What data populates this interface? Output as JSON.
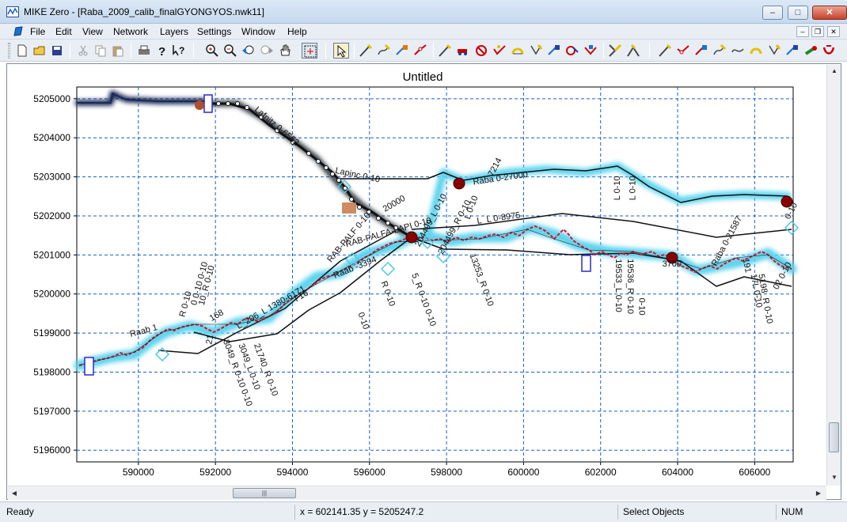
{
  "window": {
    "title": "MIKE Zero - [Raba_2009_calib_finalGYONGYOS.nwk11]",
    "minimize": "–",
    "maximize": "□",
    "close": "✕"
  },
  "menu": {
    "items": [
      "File",
      "Edit",
      "View",
      "Network",
      "Layers",
      "Settings",
      "Window",
      "Help"
    ],
    "mdi_minimize": "–",
    "mdi_restore": "❐",
    "mdi_close": "✕"
  },
  "toolbar": {
    "icons": [
      "new-icon",
      "open-icon",
      "save-icon",
      "cut-icon",
      "copy-icon",
      "paste-icon",
      "print-icon",
      "help-icon",
      "context-help-icon",
      "zoom-in-icon",
      "zoom-out-icon",
      "previous-zoom-icon",
      "next-zoom-icon",
      "pan-icon",
      "zoom-extent-icon",
      "select-icon",
      "add-point-icon",
      "add-branch-icon",
      "connect-icon",
      "disconnect-icon",
      "add-structure-icon",
      "weir-icon",
      "culvert-icon",
      "bridge-icon",
      "pump-icon",
      "gate-icon",
      "dambreak-icon",
      "user-structure-icon",
      "catchment-icon",
      "boundary-icon",
      "merge-branch-icon",
      "flip-branch-icon",
      "split-branch-icon",
      "route-icon",
      "tabulated-icon",
      "energy-loss-icon",
      "control-icon",
      "link-icon",
      "reach-icon",
      "marker-icon",
      "label-icon",
      "delete-icon"
    ]
  },
  "document": {
    "title": "Untitled"
  },
  "status": {
    "ready": "Ready",
    "coords": "x = 602141.35  y = 5205247.2",
    "mode": "Select Objects",
    "num": "NUM"
  },
  "colors": {
    "grid": "#1a5fc0",
    "branch": "#000000",
    "river": "#d8102a",
    "halo": "#5fd4ee",
    "structure": "#2a2ad0"
  },
  "chart_data": {
    "type": "map",
    "title": "Untitled",
    "x_ticks": [
      "590000",
      "592000",
      "594000",
      "596000",
      "598000",
      "600000",
      "602000",
      "604000",
      "606000"
    ],
    "y_ticks": [
      "5205000",
      "5204000",
      "5203000",
      "5202000",
      "5201000",
      "5200000",
      "5199000",
      "5198000",
      "5197000",
      "5196000"
    ],
    "xlim": [
      588400,
      607000
    ],
    "ylim": [
      5195700,
      5205300
    ],
    "grid": true,
    "labels": [
      {
        "text": "Lafnitz  0-6562",
        "x": 593000,
        "y": 5204700,
        "rot": 40
      },
      {
        "text": "Lapinc  0-10",
        "x": 595100,
        "y": 5203100,
        "rot": 12
      },
      {
        "text": "Rába  0-27000",
        "x": 598700,
        "y": 5202800,
        "rot": -8
      },
      {
        "text": "7214",
        "x": 599200,
        "y": 5203000,
        "rot": -62
      },
      {
        "text": "L_L  0-8975",
        "x": 598800,
        "y": 5201800,
        "rot": -8
      },
      {
        "text": "204499_L  0-10",
        "x": 597300,
        "y": 5201200,
        "rot": -62
      },
      {
        "text": "204499_R  0-10",
        "x": 597900,
        "y": 5201000,
        "rot": -62
      },
      {
        "text": "RAB-PALFA-LAPI  0-10",
        "x": 595400,
        "y": 5201200,
        "rot": -16
      },
      {
        "text": "RAB-PALF  0-10",
        "x": 595000,
        "y": 5200800,
        "rot": -50
      },
      {
        "text": "20000",
        "x": 596400,
        "y": 5202100,
        "rot": -30
      },
      {
        "text": "Raab  -3394",
        "x": 595100,
        "y": 5200400,
        "rot": -22
      },
      {
        "text": "13253_R  0-10",
        "x": 598600,
        "y": 5201000,
        "rot": 70
      },
      {
        "text": "R  0-10",
        "x": 596300,
        "y": 5200300,
        "rot": 70
      },
      {
        "text": "L  0-10",
        "x": 598600,
        "y": 5201900,
        "rot": -70
      },
      {
        "text": "5_R  0-10  0-10",
        "x": 597100,
        "y": 5200500,
        "rot": 70
      },
      {
        "text": "L_206_L  1380-6171",
        "x": 592600,
        "y": 5199100,
        "rot": -30
      },
      {
        "text": "I 16",
        "x": 594100,
        "y": 5199800,
        "rot": -30
      },
      {
        "text": "0-10",
        "x": 595700,
        "y": 5199500,
        "rot": 70
      },
      {
        "text": "Raab  1",
        "x": 589800,
        "y": 5198900,
        "rot": -15
      },
      {
        "text": "R  0-10",
        "x": 591200,
        "y": 5199400,
        "rot": -75
      },
      {
        "text": "0  0-10  0-10",
        "x": 591500,
        "y": 5199700,
        "rot": -75
      },
      {
        "text": "10_R  0-10",
        "x": 591700,
        "y": 5199700,
        "rot": -75
      },
      {
        "text": "168",
        "x": 591900,
        "y": 5199300,
        "rot": -30
      },
      {
        "text": "21",
        "x": 591900,
        "y": 5198700,
        "rot": -80
      },
      {
        "text": "3049_R  0-10  0-10",
        "x": 592200,
        "y": 5198800,
        "rot": 70
      },
      {
        "text": "3049_L  0-10",
        "x": 592600,
        "y": 5198700,
        "rot": 70
      },
      {
        "text": "21740_R  0-10",
        "x": 593000,
        "y": 5198700,
        "rot": 70
      },
      {
        "text": "L  0-10",
        "x": 602500,
        "y": 5202400,
        "rot": -90
      },
      {
        "text": "L  0-10",
        "x": 602900,
        "y": 5202400,
        "rot": -90
      },
      {
        "text": "19533_L  0-10",
        "x": 602400,
        "y": 5200900,
        "rot": 90
      },
      {
        "text": "19536_R  0-10",
        "x": 602700,
        "y": 5200900,
        "rot": 90
      },
      {
        "text": "0-10",
        "x": 603000,
        "y": 5199900,
        "rot": 90
      },
      {
        "text": "3700",
        "x": 603600,
        "y": 5200700,
        "rot": 0
      },
      {
        "text": "Raba  0-21587",
        "x": 605000,
        "y": 5200700,
        "rot": -62
      },
      {
        "text": "191",
        "x": 605700,
        "y": 5200900,
        "rot": 80
      },
      {
        "text": "17L  0-10",
        "x": 605900,
        "y": 5200500,
        "rot": 80
      },
      {
        "text": "5198_R  0-10",
        "x": 606100,
        "y": 5200500,
        "rot": 80
      },
      {
        "text": "02  0-10",
        "x": 606600,
        "y": 5200100,
        "rot": -62
      },
      {
        "text": "0-10",
        "x": 606900,
        "y": 5201900,
        "rot": -62
      }
    ]
  }
}
